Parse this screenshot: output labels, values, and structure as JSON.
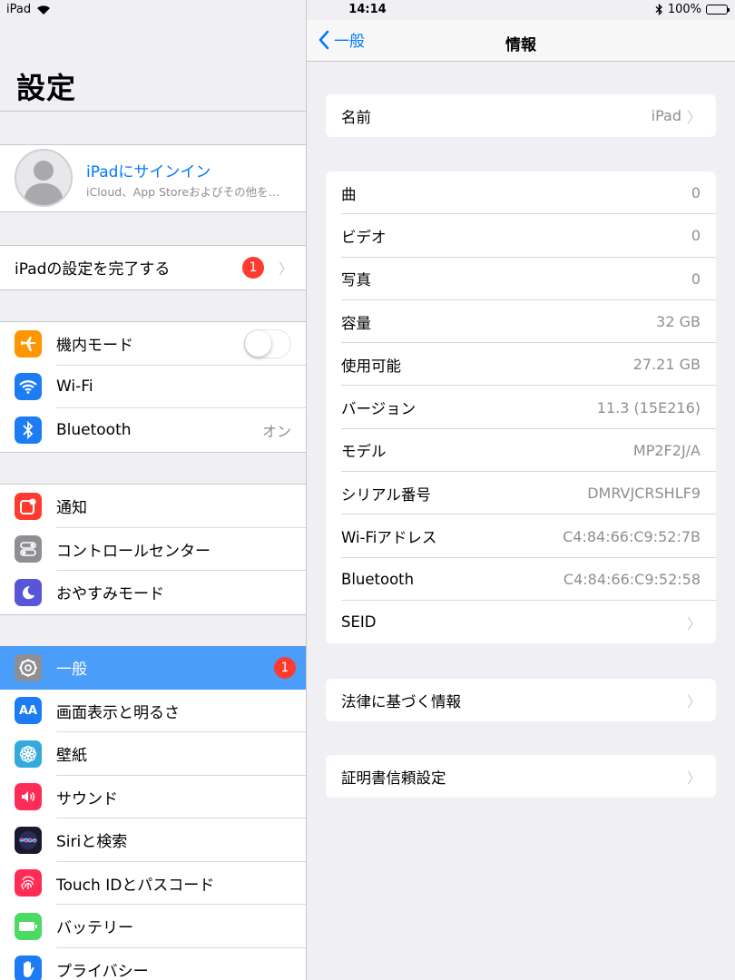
{
  "status_bar": {
    "device": "iPad",
    "time": "14:14",
    "battery": "100%"
  },
  "sidebar": {
    "title": "設定",
    "profile": {
      "title": "iPadにサインイン",
      "subtitle": "iCloud、App Storeおよびその他を…"
    },
    "setup": {
      "label": "iPadの設定を完了する",
      "badge": "1"
    },
    "connectivity": [
      {
        "label": "機内モード",
        "icon": "airplane-icon",
        "color": "#ff9500"
      },
      {
        "label": "Wi-Fi",
        "icon": "wifi-icon",
        "color": "#1c7cf4"
      },
      {
        "label": "Bluetooth",
        "value": "オン",
        "icon": "bluetooth-icon",
        "color": "#1c7cf4"
      }
    ],
    "notifications_group": [
      {
        "label": "通知",
        "icon": "notification-icon",
        "color": "#ff3b30"
      },
      {
        "label": "コントロールセンター",
        "icon": "control-center-icon",
        "color": "#8e8e93"
      },
      {
        "label": "おやすみモード",
        "icon": "moon-icon",
        "color": "#5856d6"
      }
    ],
    "general_group": [
      {
        "label": "一般",
        "badge": "1",
        "icon": "gear-icon",
        "color": "#8e8e93",
        "selected": true
      },
      {
        "label": "画面表示と明るさ",
        "icon": "display-icon",
        "color": "#1c7cf4"
      },
      {
        "label": "壁紙",
        "icon": "wallpaper-icon",
        "color": "#34aadc"
      },
      {
        "label": "サウンド",
        "icon": "sound-icon",
        "color": "#ff2d55"
      },
      {
        "label": "Siriと検索",
        "icon": "siri-icon",
        "color": "#222"
      },
      {
        "label": "Touch IDとパスコード",
        "icon": "fingerprint-icon",
        "color": "#ff2d55"
      },
      {
        "label": "バッテリー",
        "icon": "battery-icon",
        "color": "#4cd964"
      },
      {
        "label": "プライバシー",
        "icon": "hand-icon",
        "color": "#1c7cf4"
      }
    ]
  },
  "nav": {
    "back": "一般",
    "title": "情報"
  },
  "about": {
    "name": {
      "label": "名前",
      "value": "iPad"
    },
    "details": [
      {
        "label": "曲",
        "value": "0"
      },
      {
        "label": "ビデオ",
        "value": "0"
      },
      {
        "label": "写真",
        "value": "0"
      },
      {
        "label": "容量",
        "value": "32 GB"
      },
      {
        "label": "使用可能",
        "value": "27.21 GB"
      },
      {
        "label": "バージョン",
        "value": "11.3 (15E216)"
      },
      {
        "label": "モデル",
        "value": "MP2F2J/A"
      },
      {
        "label": "シリアル番号",
        "value": "DMRVJCRSHLF9"
      },
      {
        "label": "Wi-Fiアドレス",
        "value": "C4:84:66:C9:52:7B"
      },
      {
        "label": "Bluetooth",
        "value": "C4:84:66:C9:52:58"
      },
      {
        "label": "SEID"
      }
    ],
    "legal": {
      "label": "法律に基づく情報"
    },
    "certs": {
      "label": "証明書信頼設定"
    }
  }
}
